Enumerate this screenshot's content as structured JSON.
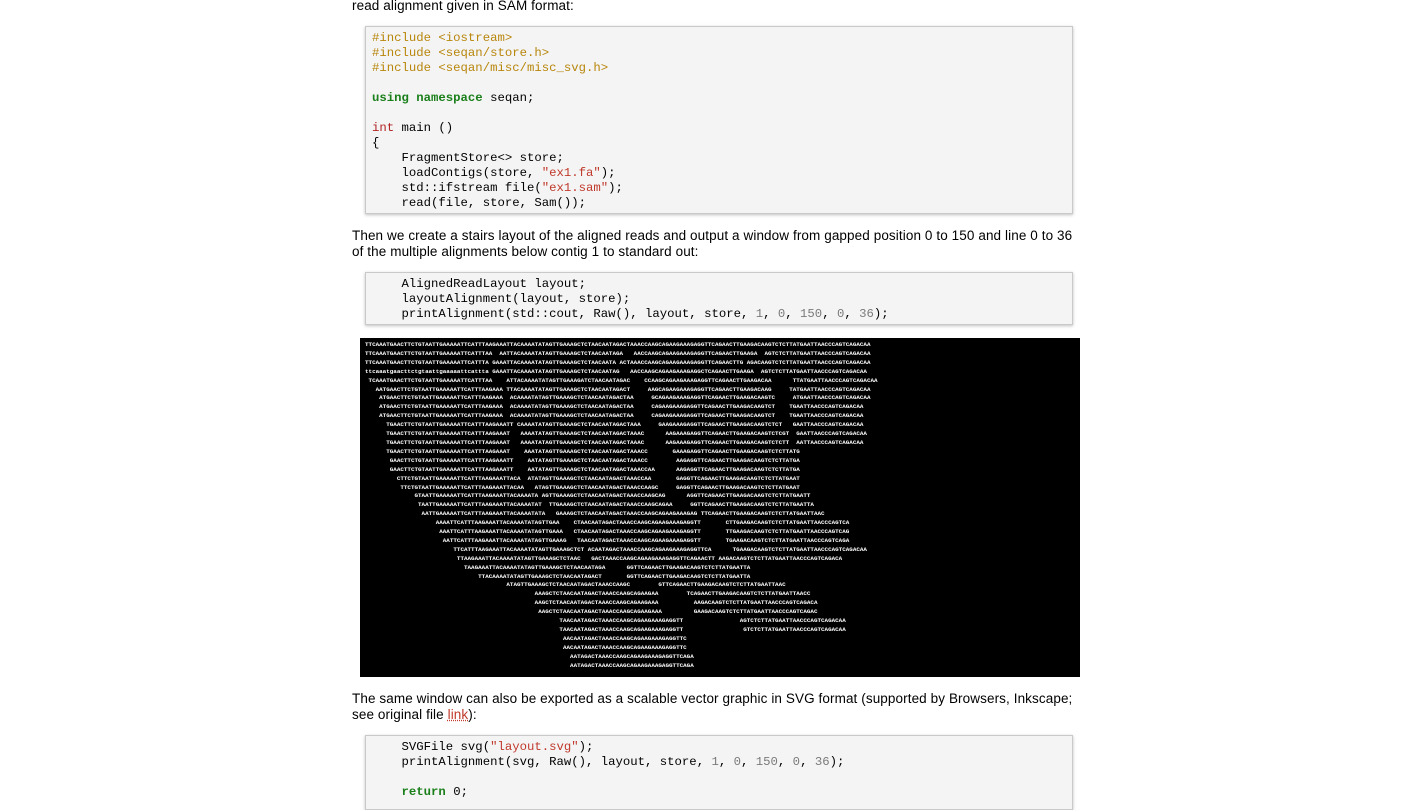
{
  "intro_text": "read alignment given in SAM format:",
  "code1": {
    "include1": "#include <iostream>",
    "include2": "#include <seqan/store.h>",
    "include3": "#include <seqan/misc/misc_svg.h>",
    "using_kw": "using namespace",
    "using_rest": " seqan;",
    "int_kw": "int",
    "main_rest": " main ()",
    "brace": "{",
    "l1": "    FragmentStore<> store;",
    "l2a": "    loadContigs(store, ",
    "l2s": "\"ex1.fa\"",
    "l2b": ");",
    "l3a": "    std::ifstream file(",
    "l3s": "\"ex1.sam\"",
    "l3b": ");",
    "l4": "    read(file, store, Sam());"
  },
  "para2": "Then we create a stairs layout of the aligned reads and output a window from gapped position 0 to 150 and line 0 to 36 of the multiple alignments below contig 1 to standard out:",
  "code2": {
    "l1": "    AlignedReadLayout layout;",
    "l2": "    layoutAlignment(layout, store);",
    "l3a": "    printAlignment(std::cout, Raw(), layout, store, ",
    "n1": "1",
    "n2": "0",
    "n3": "150",
    "n4": "0",
    "n5": "36",
    "sep": ", ",
    "l3b": ");"
  },
  "alignment_lines": [
    "TTCAAATGAACTTCTGTAATTGAAAAATTCATTTAAGAAATTACAAAATATAGTTGAAAGCTCTAACAATAGACTAAACCAAGCAGAAGAAAGAGGTTCAGAACTTGAAGACAAGTCTCTTATGAATTAACCCAGTCAGACAA",
    "TTCAAATGAACTTCTGTAATTGAAAAATTCATTTAA  AATTACAAAATATAGTTGAAAGCTCTAACAATAGA   AACCAAGCAGAAGAAAGAGGTTCAGAACTTGAAGA  AGTCTCTTATGAATTAACCCAGTCAGACAA",
    "TTCAAATGAACTTCTGTAATTGAAAAATTCATTTA GAAATTACAAAATATAGTTGAAAGCTCTAACAATA ACTAAACCAAGCAGAAGAAAGAGGTTCAGAACTTG AGACAAGTCTCTTATGAATTAACCCAGTCAGACAA",
    "ttcaaatgaacttctgtaattgaaaaattcattta GAAATTACAAAATATAGTTGAAAGCTCTAACAATAG   AACCAAGCAGAAGAAAGAGGCTCAGAACTTGAAGA  AGTCTCTTATGAATTAACCCAGTCAGACAA",
    " TCAAATGAACTTCTGTAATTGAAAAATTCATTTAA    ATTACAAAATATAGTTGAAAGATCTAACAATAGAC    CCAAGCAGAAGAAAGAGGTTCAGAACTTGAAGACAA      TTATGAATTAACCCAGTCAGACAA",
    "   AATGAACTTCTGTAATTGAAAAATTCATTTAAGAAA TTACAAAATATAGTTGAAAGCTCTAACAATAGACT     AAGCAGAAGAAAGAGGTTCAGAACTTGAAGACAAG     TATGAATTAACCCAGTCAGACAA",
    "    ATGAACTTCTGTAATTGAAAAATTCATTTAAGAAA  ACAAAATATAGTTGAAAGCTCTAACAATAGACTAA     GCAGAAGAAAGAGGTTCAGAACTTGAAGACAAGTC     ATGAATTAACCCAGTCAGACAA",
    "    ATGAACTTCTGTAATTGAAAAATTCATTTAAGAAA  ACAAAATATAGTTGAAAGCTCTAACAATAGACTAA     CAGAAGAAAGAGGTTCAGAACTTGAAGACAAGTCT    TGAATTAACCCAGTCAGACAA",
    "    ATGAACTTCTGTAATTGAAAAATTCATTTAAGAAA  ACAAAATATAGTTGAAAGCTCTAACAATAGACTAA     CAGAAGAAAGAGGTTCAGAACTTGAAGACAAGTCT    TGAATTAACCCAGTCAGACAA",
    "      TGAACTTCTGTAATTGAAAAATTCATTTAAGAAATT CAAAATATAGTTGAAAGCTCTAACAATAGACTAAA     GAAGAAAGAGGTTCAGAACTTGAAGACAAGTCTCT   GAATTAACCCAGTCAGACAA",
    "      TGAACTTCTGTAATTGAAAAATTCATTTAAGAAAT   AAAATATAGTTGAAAGCTCTAACAATAGACTAAAC      AAGAAAGAGGTTCAGAACTTGAAGACAAGTCTCGT  GAATTAACCCAGTCAGACAA",
    "      TGAACTTCTGTAATTGAAAAATTCATTTAAGAAAT   AAAATATAGTTGAAAGCTCTAACAATAGACTAAAC      AAGAAAGAGGTTCAGAACTTGAAGACAAGTCTCTT  AATTAACCCAGTCAGACAA",
    "      TGAACTTCTGTAATTGAAAAATTCATTTAAGAAAT    AAATATAGTTGAAAGCTCTAACAATAGACTAAACC       GAAAGAGGTTCAGAACTTGAAGACAAGTCTCTTATG",
    "       GAACTTCTGTAATTGAAAAATTCATTTAAGAAATT    AATATAGTTGAAAGCTCTAACAATAGACTAAACC        AAGAGGTTCAGAACTTGAAGACAAGTCTCTTATGA",
    "       GAACTTCTGTAATTGAAAAATTCATTTAAGAAATT    AATATAGTTGAAAGCTCTAACAATAGACTAAACCAA      AAGAGGTTCAGAACTTGAAGACAAGTCTCTTATGA",
    "         CTTCTGTAATTGAAAAATTCATTTAAGAAATTACA  ATATAGTTGAAAGCTCTAACAATAGACTAAACCAA       GAGGTTCAGAACTTGAAGACAAGTCTCTTATGAAT",
    "          TTCTGTAATTGAAAAATTCATTTAAGAAATTACAA   ATAGTTGAAAGCTCTAACAATAGACTAAACCAAGC     GAGGTTCAGAACTTGAAGACAAGTCTCTTATGAAT",
    "              GTAATTGAAAAATTCATTTAAGAAATTACAAAATA AGTTGAAAGCTCTAACAATAGACTAAACCAAGCAG      AGGTTCAGAACTTGAAGACAAGTCTCTTATGAATT",
    "               TAATTGAAAAATTCATTTAAGAAATTACAAAATAT  TTGAAAGCTCTAACAATAGACTAAACCAAGCAGAA     GGTTCAGAACTTGAAGACAAGTCTCTTATGAATTA",
    "                AATTGAAAAATTCATTTAAGAAATTACAAAATATA   GAAAGCTCTAACAATAGACTAAACCAAGCAGAAGAAAGAG TTCAGAACTTGAAGACAAGTCTCTTATGAATTAAC",
    "                    AAAATTCATTTAAGAAATTACAAAATATAGTTGAA    CTAACAATAGACTAAACCAAGCAGAAGAAAGAGGTT       CTTGAAGACAAGTCTCTTATGAATTAACCCAGTCA",
    "                     AAATTCATTTAAGAAATTACAAAATATAGTTGAAA   CTAACAATAGACTAAACCAAGCAGAAGAAAGAGGTT       TTGAAGACAAGTCTCTTATGAATTAACCCAGTCAG",
    "                      AATTCATTTAAGAAATTACAAAATATAGTTGAAAG   TAACAATAGACTAAACCAAGCAGAAGAAAGAGGTT       TGAAGACAAGTCTCTTATGAATTAACCCAGTCAGA",
    "                         TTCATTTAAGAAATTACAAAATATAGTTGAAAGCTCT ACAATAGACTAAACCAAGCAGAAGAAAGAGGTTCA      TGAAGACAAGTCTCTTATGAATTAACCCAGTCAGACAA",
    "                          TTAAGAAATTACAAAATATAGTTGAAAGCTCTAAC   GACTAAACCAAGCAGAAGAAAGAGGTTCAGAACTT AAGACAAGTCTCTTATGAATTAACCCAGTCAGACA",
    "                            TAAGAAATTACAAAATATAGTTGAAAGCTCTAACAATAGA      GGTTCAGAACTTGAAGACAAGTCTCTTATGAATTA",
    "                                TTACAAAATATAGTTGAAAGCTCTAACAATAGACT       GGTTCAGAACTTGAAGACAAGTCTCTTATGAATTA",
    "                                        ATAGTTGAAAGCTCTAACAATAGACTAAACCAAGC        GTTCAGAACTTGAAGACAAGTCTCTTATGAATTAAC",
    "                                                AAAGCTCTAACAATAGACTAAACCAAGCAGAAGAA        TCAGAACTTGAAGACAAGTCTCTTATGAATTAACC",
    "                                                AAGCTCTAACAATAGACTAAACCAAGCAGAAGAAA          AAGACAAGTCTCTTATGAATTAACCCAGTCAGACA",
    "                                                 AAGCTCTAACAATAGACTAAACCAAGCAGAAGAAA         GAAGACAAGTCTCTTATGAATTAACCCAGTCAGAC",
    "                                                       TAACAATAGACTAAACCAAGCAGAAGAAAGAGGTT                AGTCTCTTATGAATTAACCCAGTCAGACAA",
    "                                                       TAACAATAGACTAAACCAAGCAGAAGAAAGAGGTT                 GTCTCTTATGAATTAACCCAGTCAGACAA",
    "                                                        AACAATAGACTAAACCAAGCAGAAGAAAGAGGTTC",
    "                                                        AACAATAGACTAAACCAAGCAGAAGAAAGAGGTTC",
    "                                                          AATAGACTAAACCAAGCAGAAGAAAGAGGTTCAGA",
    "                                                          AATAGACTAAACCAAGCAGAAGAAAGAGGTTCAGA"
  ],
  "para3_a": "The same window can also be exported as a scalable vector graphic in SVG format (supported by Browsers, Inkscape; see original file ",
  "para3_link": "link",
  "para3_b": "):",
  "code3": {
    "l1a": "    SVGFile svg(",
    "l1s": "\"layout.svg\"",
    "l1b": ");",
    "l2a": "    printAlignment(svg, Raw(), layout, store, ",
    "n1": "1",
    "n2": "0",
    "n3": "150",
    "n4": "0",
    "n5": "36",
    "sep": ", ",
    "l2b": ");",
    "ret_kw": "return",
    "ret_rest": " 0;"
  }
}
